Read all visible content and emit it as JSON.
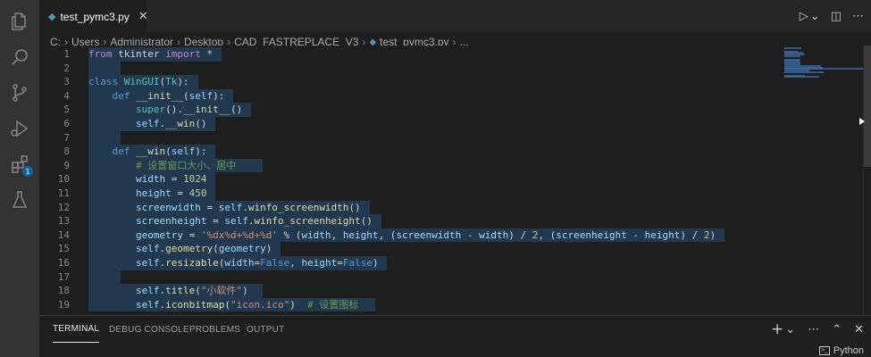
{
  "tab": {
    "filename": "test_pymc3.py",
    "close": "✕"
  },
  "editor_actions": {
    "run": "▷",
    "run_dropdown": "⌄",
    "split": "◫",
    "more": "⋯"
  },
  "breadcrumb": {
    "parts": [
      "C:",
      "Users",
      "Administrator",
      "Desktop",
      "CAD_FASTREPLACE_V3"
    ],
    "file": "test_pymc3.py",
    "tail": "..."
  },
  "activity": {
    "extensions_badge": "1"
  },
  "code_lines": [
    {
      "n": "1",
      "tokens": [
        [
          "kw2",
          "from"
        ],
        [
          "plain",
          " tkinter "
        ],
        [
          "kw2",
          "import"
        ],
        [
          "plain",
          " *"
        ]
      ]
    },
    {
      "n": "2",
      "tokens": []
    },
    {
      "n": "3",
      "tokens": [
        [
          "kw",
          "class"
        ],
        [
          "plain",
          " "
        ],
        [
          "cls",
          "WinGUI"
        ],
        [
          "plain",
          "("
        ],
        [
          "cls",
          "Tk"
        ],
        [
          "plain",
          "):"
        ]
      ]
    },
    {
      "n": "4",
      "tokens": [
        [
          "plain",
          "    "
        ],
        [
          "kw",
          "def"
        ],
        [
          "plain",
          " "
        ],
        [
          "fn",
          "__init__"
        ],
        [
          "plain",
          "("
        ],
        [
          "var",
          "self"
        ],
        [
          "plain",
          "):"
        ]
      ]
    },
    {
      "n": "5",
      "tokens": [
        [
          "plain",
          "        "
        ],
        [
          "cls",
          "super"
        ],
        [
          "plain",
          "()."
        ],
        [
          "fn",
          "__init__"
        ],
        [
          "plain",
          "()"
        ]
      ]
    },
    {
      "n": "6",
      "tokens": [
        [
          "plain",
          "        "
        ],
        [
          "var",
          "self"
        ],
        [
          "plain",
          "."
        ],
        [
          "fn",
          "__win"
        ],
        [
          "plain",
          "()"
        ]
      ]
    },
    {
      "n": "7",
      "tokens": []
    },
    {
      "n": "8",
      "tokens": [
        [
          "plain",
          "    "
        ],
        [
          "kw",
          "def"
        ],
        [
          "plain",
          " "
        ],
        [
          "fn",
          "__win"
        ],
        [
          "plain",
          "("
        ],
        [
          "var",
          "self"
        ],
        [
          "plain",
          "):"
        ]
      ]
    },
    {
      "n": "9",
      "tokens": [
        [
          "plain",
          "        "
        ],
        [
          "cmt",
          "# 设置窗口大小、居中"
        ]
      ]
    },
    {
      "n": "10",
      "tokens": [
        [
          "plain",
          "        "
        ],
        [
          "var",
          "width"
        ],
        [
          "plain",
          " = "
        ],
        [
          "num",
          "1024"
        ]
      ]
    },
    {
      "n": "11",
      "tokens": [
        [
          "plain",
          "        "
        ],
        [
          "var",
          "height"
        ],
        [
          "plain",
          " = "
        ],
        [
          "num",
          "450"
        ]
      ]
    },
    {
      "n": "12",
      "tokens": [
        [
          "plain",
          "        "
        ],
        [
          "var",
          "screenwidth"
        ],
        [
          "plain",
          " = "
        ],
        [
          "var",
          "self"
        ],
        [
          "plain",
          "."
        ],
        [
          "fn",
          "winfo_screenwidth"
        ],
        [
          "plain",
          "()"
        ]
      ]
    },
    {
      "n": "13",
      "tokens": [
        [
          "plain",
          "        "
        ],
        [
          "var",
          "screenheight"
        ],
        [
          "plain",
          " = "
        ],
        [
          "var",
          "self"
        ],
        [
          "plain",
          "."
        ],
        [
          "fn",
          "winfo_screenheight"
        ],
        [
          "plain",
          "()"
        ]
      ]
    },
    {
      "n": "14",
      "tokens": [
        [
          "plain",
          "        "
        ],
        [
          "var",
          "geometry"
        ],
        [
          "plain",
          " = "
        ],
        [
          "str",
          "'%dx%d+%d+%d'"
        ],
        [
          "plain",
          " % ("
        ],
        [
          "var",
          "width"
        ],
        [
          "plain",
          ", "
        ],
        [
          "var",
          "height"
        ],
        [
          "plain",
          ", ("
        ],
        [
          "var",
          "screenwidth"
        ],
        [
          "plain",
          " - "
        ],
        [
          "var",
          "width"
        ],
        [
          "plain",
          ") / "
        ],
        [
          "num",
          "2"
        ],
        [
          "plain",
          ", ("
        ],
        [
          "var",
          "screenheight"
        ],
        [
          "plain",
          " - "
        ],
        [
          "var",
          "height"
        ],
        [
          "plain",
          ") / "
        ],
        [
          "num",
          "2"
        ],
        [
          "plain",
          ")"
        ]
      ]
    },
    {
      "n": "15",
      "tokens": [
        [
          "plain",
          "        "
        ],
        [
          "var",
          "self"
        ],
        [
          "plain",
          "."
        ],
        [
          "fn",
          "geometry"
        ],
        [
          "plain",
          "("
        ],
        [
          "var",
          "geometry"
        ],
        [
          "plain",
          ")"
        ]
      ]
    },
    {
      "n": "16",
      "tokens": [
        [
          "plain",
          "        "
        ],
        [
          "var",
          "self"
        ],
        [
          "plain",
          "."
        ],
        [
          "fn",
          "resizable"
        ],
        [
          "plain",
          "("
        ],
        [
          "var",
          "width"
        ],
        [
          "plain",
          "="
        ],
        [
          "kw",
          "False"
        ],
        [
          "plain",
          ", "
        ],
        [
          "var",
          "height"
        ],
        [
          "plain",
          "="
        ],
        [
          "kw",
          "False"
        ],
        [
          "plain",
          ")"
        ]
      ]
    },
    {
      "n": "17",
      "tokens": []
    },
    {
      "n": "18",
      "tokens": [
        [
          "plain",
          "        "
        ],
        [
          "var",
          "self"
        ],
        [
          "plain",
          "."
        ],
        [
          "fn",
          "title"
        ],
        [
          "plain",
          "("
        ],
        [
          "str",
          "\"小软件\""
        ],
        [
          "plain",
          ")"
        ]
      ]
    },
    {
      "n": "19",
      "tokens": [
        [
          "plain",
          "        "
        ],
        [
          "var",
          "self"
        ],
        [
          "plain",
          "."
        ],
        [
          "fn",
          "iconbitmap"
        ],
        [
          "plain",
          "("
        ],
        [
          "str",
          "\"icon.ico\""
        ],
        [
          "plain",
          ")  "
        ],
        [
          "cmt",
          "# 设置图标"
        ]
      ]
    }
  ],
  "panel": {
    "tabs": [
      "TERMINAL",
      "DEBUG CONSOLE",
      "PROBLEMS",
      "OUTPUT"
    ],
    "active": "TERMINAL",
    "actions": {
      "add": "+",
      "add_dropdown": "⌄",
      "more": "⋯",
      "maximize": "⌃",
      "close": "✕"
    },
    "terminal_name": "Python"
  },
  "colors": {
    "background": "#1e1e1e",
    "activity_bar": "#333333",
    "selection": "#264f78",
    "keyword": "#569cd6",
    "control_keyword": "#c586c0",
    "function": "#dcdcaa",
    "class": "#4ec9b0",
    "variable": "#9cdcfe",
    "string": "#ce9178",
    "number": "#b5cea8",
    "comment": "#6a9955"
  }
}
